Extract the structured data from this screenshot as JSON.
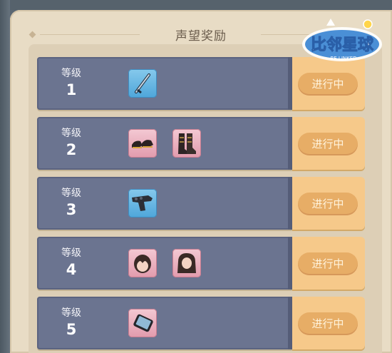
{
  "panel": {
    "title": "声望奖励"
  },
  "logo": {
    "text": "比邻星球",
    "subtext": "BE LINKED"
  },
  "rows": [
    {
      "level_label": "等级",
      "level": "1",
      "status": "进行中"
    },
    {
      "level_label": "等级",
      "level": "2",
      "status": "进行中"
    },
    {
      "level_label": "等级",
      "level": "3",
      "status": "进行中"
    },
    {
      "level_label": "等级",
      "level": "4",
      "status": "进行中"
    },
    {
      "level_label": "等级",
      "level": "5",
      "status": "进行中"
    }
  ],
  "icons": {
    "row1": [
      "sword-item-icon"
    ],
    "row2": [
      "shoes-item-icon",
      "boots-item-icon"
    ],
    "row3": [
      "gun-item-icon"
    ],
    "row4": [
      "short-hair-item-icon",
      "long-hair-item-icon"
    ],
    "row5": [
      "phone-item-icon"
    ]
  },
  "colors": {
    "row": "#6b7490",
    "status_cap": "#f6c98a",
    "status_button": "#e7ad66",
    "panel": "#e8dcc5",
    "item_blue": "#5fb3e2",
    "item_pink": "#e9a9b9"
  }
}
